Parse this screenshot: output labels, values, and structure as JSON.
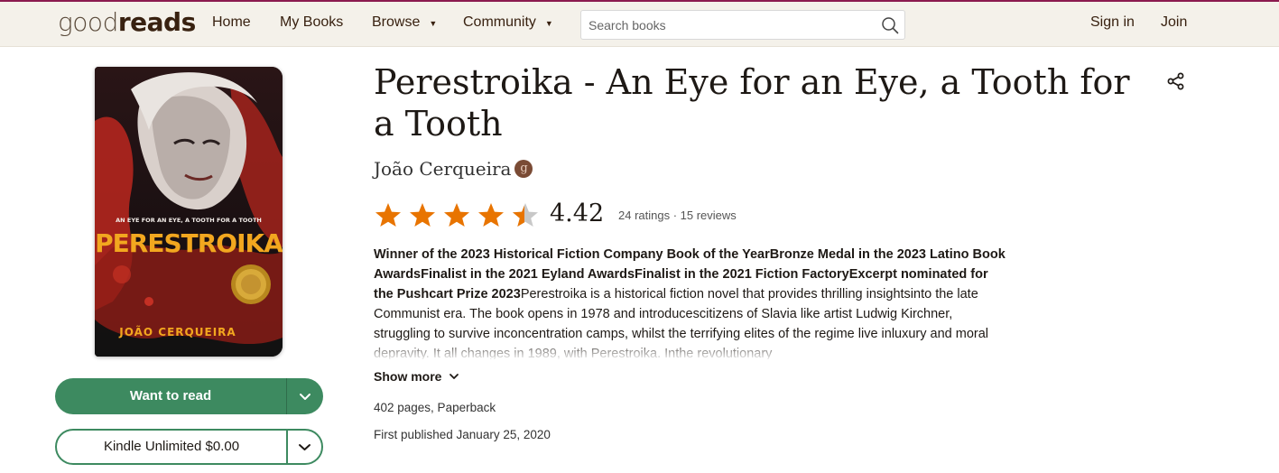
{
  "header": {
    "logo_light": "good",
    "logo_dark": "reads",
    "nav": [
      "Home",
      "My Books",
      "Browse",
      "Community"
    ],
    "search_placeholder": "Search books",
    "sign_in": "Sign in",
    "join": "Join"
  },
  "cover": {
    "tagline": "AN EYE FOR AN EYE, A TOOTH FOR A TOOTH",
    "title": "PERESTROIKA",
    "author": "JOÃO CERQUEIRA"
  },
  "buttons": {
    "want_to_read": "Want to read",
    "kindle": "Kindle Unlimited $0.00"
  },
  "book": {
    "title": "Perestroika - An Eye for an Eye, a Tooth for a Tooth",
    "author": "João Cerqueira",
    "author_badge": "g",
    "rating_value": 4.42,
    "rating": "4.42",
    "counts": "24 ratings · 15 reviews",
    "description_bold": "Winner of the 2023 Historical Fiction Company Book of the YearBronze Medal in the 2023 Latino Book AwardsFinalist in the 2021 Eyland AwardsFinalist in the 2021 Fiction FactoryExcerpt nominated for the Pushcart Prize 2023",
    "description_text": "Perestroika is a historical fiction novel that provides thrilling insightsinto the late Communist era. The book opens in 1978 and introducescitizens of Slavia like artist Ludwig Kirchner, struggling to survive inconcentration camps, whilst the terrifying elites of the regime live inluxury and moral depravity. It all changes in 1989, with Perestroika. Inthe revolutionary",
    "show_more": "Show more",
    "pages_format": "402 pages, Paperback",
    "first_published": "First published January 25, 2020"
  },
  "colors": {
    "accent_green": "#3d8a60",
    "star_orange": "#e87400",
    "header_bg": "#f4f1ea",
    "brand_maroon": "#8b1a4f"
  }
}
